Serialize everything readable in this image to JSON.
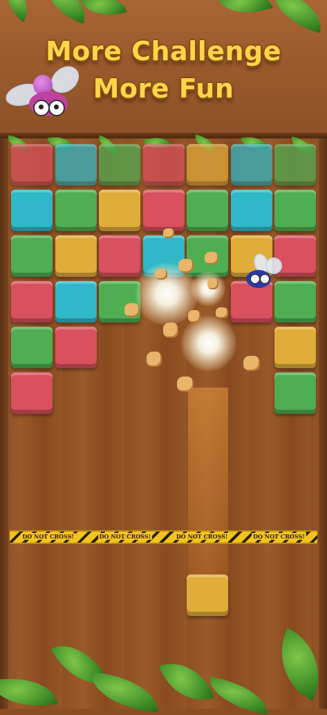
{
  "header": {
    "line1": "More Challenge",
    "line2": "More Fun"
  },
  "tape": {
    "text": "DO NOT CROSS!",
    "repeats": [
      "DO NOT CROSS!",
      "DO NOT CROSS!",
      "DO NOT CROSS!",
      "DO NOT CROSS!"
    ]
  },
  "colors": {
    "red": "#d9505e",
    "cyan": "#2fb8c8",
    "green": "#4fae52",
    "yellow": "#e0ac3a",
    "title": "#ffd54a"
  },
  "board": {
    "rows": [
      [
        "red",
        "cyan",
        "green",
        "red",
        "yellow",
        "cyan",
        "green"
      ],
      [
        "cyan",
        "green",
        "yellow",
        "red",
        "green",
        "cyan",
        "green"
      ],
      [
        "green",
        "yellow",
        "red",
        "cyan",
        "green",
        "yellow",
        "red"
      ],
      [
        "red",
        "cyan",
        "green",
        null,
        null,
        "red",
        "green"
      ],
      [
        "green",
        "red",
        null,
        null,
        null,
        null,
        "yellow"
      ],
      [
        "red",
        null,
        null,
        null,
        null,
        null,
        "green"
      ]
    ],
    "falling_block": "yellow",
    "mascots": [
      "bug-mascot-header",
      "bug-mascot-board"
    ]
  }
}
